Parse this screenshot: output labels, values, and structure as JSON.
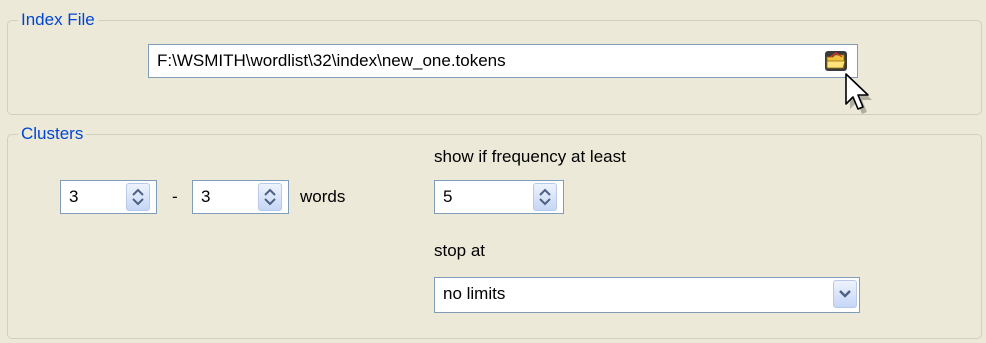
{
  "index_file": {
    "group_title": "Index File",
    "path_value": "F:\\WSMITH\\wordlist\\32\\index\\new_one.tokens",
    "browse_icon": "folder-open-icon"
  },
  "clusters": {
    "group_title": "Clusters",
    "min_words": "3",
    "range_separator": "-",
    "max_words": "3",
    "words_label": "words",
    "frequency_label": "show if frequency at least",
    "frequency_value": "5",
    "stop_at_label": "stop at",
    "stop_at_value": "no limits"
  },
  "colors": {
    "group_title": "#0046d5",
    "field_border": "#7f9db9",
    "background": "#ece9d8"
  }
}
